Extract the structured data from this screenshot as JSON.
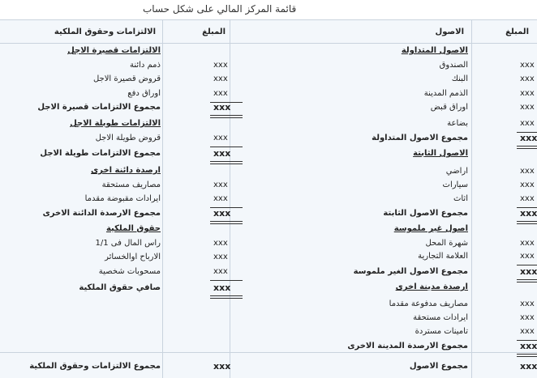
{
  "title": "قائمة المركز المالي على شكل حساب",
  "headers": {
    "assets_amount": "المبلغ",
    "assets": "الاصول",
    "liabilities_amount": "المبلغ",
    "liabilities": "الالتزامات وحقوق الملكية"
  },
  "assets": {
    "current_title": "الاصول المتداولة",
    "current_items": [
      "الصندوق",
      "البنك",
      "الذمم المدينة",
      "اوراق قبض",
      "بضاعة"
    ],
    "current_total": "مجموع الاصول المتداولة",
    "fixed_title": "الاصول الثابتة",
    "fixed_items": [
      "اراضي",
      "سيارات",
      "اثاث"
    ],
    "fixed_total": "مجموع الاصول الثابتة",
    "intangible_title": "اصول غير ملموسة",
    "intangible_items": [
      "شهرة المحل",
      "العلامة التجارية"
    ],
    "intangible_total": "مجموع الاصول الغير ملموسة",
    "debit_title": "ارصدة مدينة اخرى",
    "debit_items": [
      "مصاريف مدفوعة مقدما",
      "ايرادات مستحقة",
      "تامينات مستردة"
    ],
    "debit_total": "مجموع الارصدة المدينة الاخرى",
    "grand_total": "مجموع الاصول"
  },
  "liabilities": {
    "short_title": "الالتزامات قصيرة الاجل",
    "short_items": [
      "ذمم دائنة",
      "قروض قصيرة الاجل",
      "اوراق دفع"
    ],
    "short_total": "مجموع الالتزامات قصيرة الاجل",
    "long_title": "الالتزامات طويلة الاجل",
    "long_items": [
      "قروض طويلة الاجل"
    ],
    "long_total": "مجموع الالتزامات طويلة الاجل",
    "credit_title": "ارصدة دائنة اخرى",
    "credit_items": [
      "مصاريف مستحقة",
      "ايرادات مقبوضة مقدما"
    ],
    "credit_total": "مجموع الارصدة الدائنة الاخرى",
    "equity_title": "حقوق الملكية",
    "equity_items": [
      "راس المال فى 1/1",
      "الارباح اوالخسائر",
      "مسحوبات شخصية"
    ],
    "equity_total": "صافي حقوق الملكية",
    "grand_total": "مجموع الالتزامات وحقوق الملكية"
  },
  "amount_placeholder": "xxx"
}
